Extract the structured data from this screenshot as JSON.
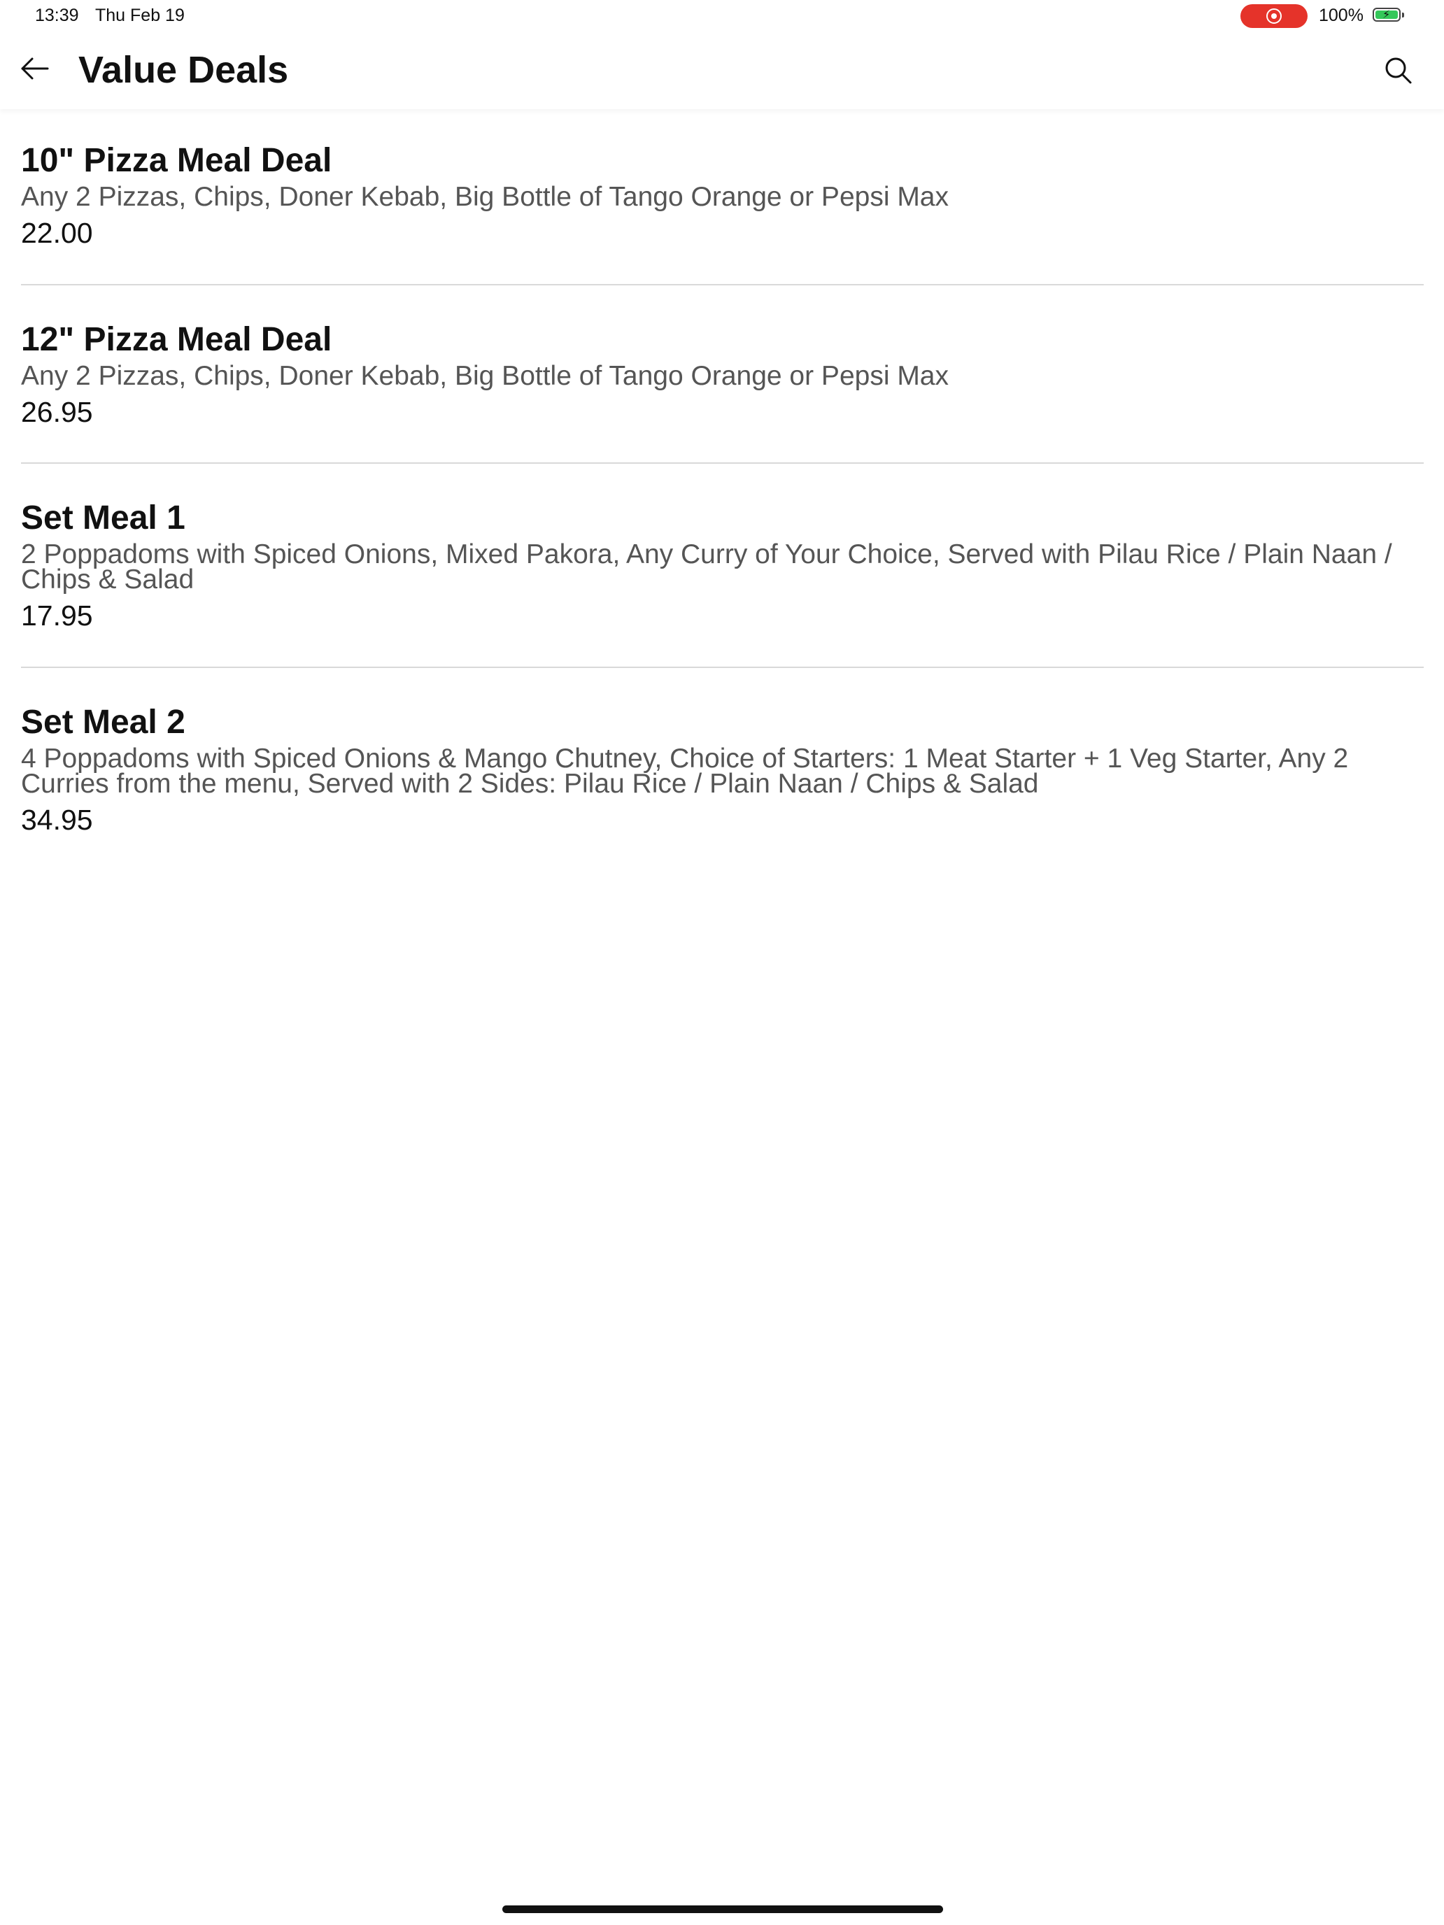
{
  "status_bar": {
    "time": "13:39",
    "date": "Thu Feb 19",
    "battery_percent": "100%",
    "battery_level": 1.0,
    "record_color": "#e5332a",
    "battery_color": "#34c759"
  },
  "header": {
    "title": "Value Deals",
    "back_icon": "arrow-left-icon",
    "search_icon": "search-icon"
  },
  "deals": [
    {
      "name": "10\" Pizza Meal Deal",
      "description": "Any 2 Pizzas, Chips, Doner Kebab, Big Bottle of Tango Orange or Pepsi Max",
      "price": "22.00"
    },
    {
      "name": "12\" Pizza Meal Deal",
      "description": "Any 2 Pizzas, Chips, Doner Kebab, Big Bottle of Tango Orange or Pepsi Max",
      "price": "26.95"
    },
    {
      "name": "Set Meal 1",
      "description": "2 Poppadoms with Spiced Onions, Mixed Pakora, Any Curry of Your Choice, Served with Pilau Rice / Plain Naan / Chips & Salad",
      "price": "17.95"
    },
    {
      "name": "Set Meal 2",
      "description": "4 Poppadoms with Spiced Onions & Mango Chutney, Choice of Starters: 1 Meat Starter + 1 Veg Starter, Any 2 Curries from the menu, Served with 2 Sides: Pilau Rice / Plain Naan / Chips & Salad",
      "price": "34.95"
    }
  ]
}
